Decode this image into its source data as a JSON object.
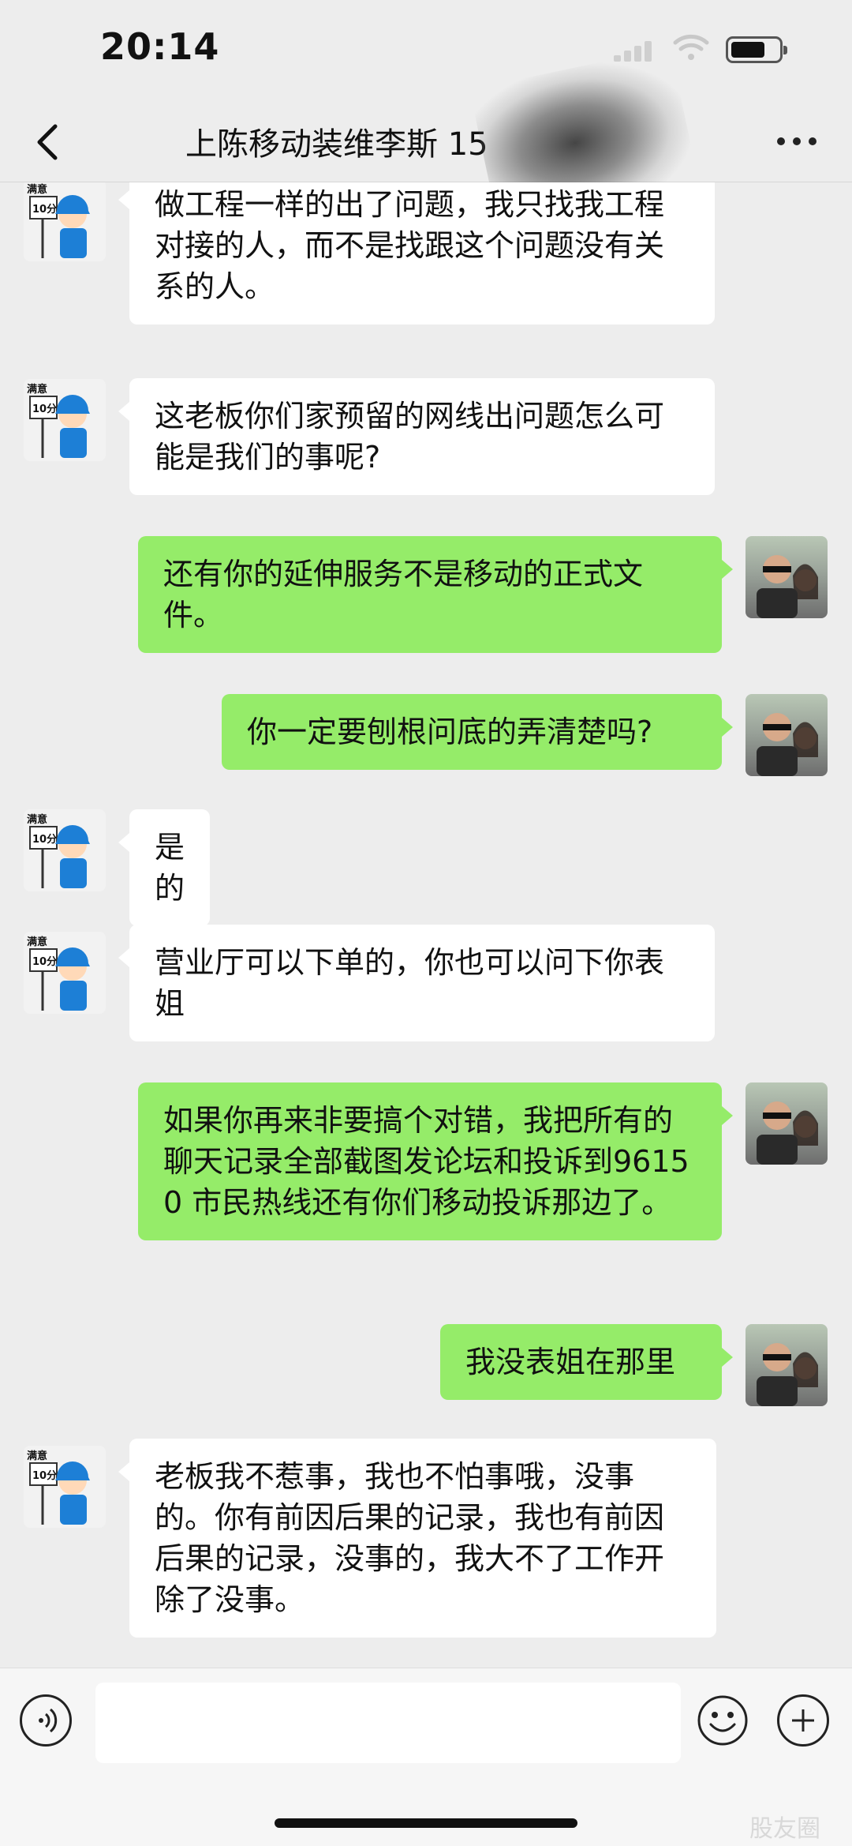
{
  "status": {
    "time": "20:14"
  },
  "header": {
    "title": "上陈移动装维李斯 15"
  },
  "messages": [
    {
      "from": "agent",
      "text": "做工程一样的出了问题，我只找我工程对接的人，而不是找跟这个问题没有关系的人。"
    },
    {
      "from": "agent",
      "text": "这老板你们家预留的网线出问题怎么可能是我们的事呢?"
    },
    {
      "from": "user",
      "text": "还有你的延伸服务不是移动的正式文件。"
    },
    {
      "from": "user",
      "text": "你一定要刨根问底的弄清楚吗?"
    },
    {
      "from": "agent",
      "text": "是的"
    },
    {
      "from": "agent",
      "text": "营业厅可以下单的，你也可以问下你表姐"
    },
    {
      "from": "user",
      "text": "如果你再来非要搞个对错，我把所有的聊天记录全部截图发论坛和投诉到96150 市民热线还有你们移动投诉那边了。"
    },
    {
      "from": "user",
      "text": "我没表姐在那里"
    },
    {
      "from": "agent",
      "text": "老板我不惹事，我也不怕事哦，没事的。你有前因后果的记录，我也有前因后果的记录，没事的，我大不了工作开除了没事。"
    }
  ],
  "agent_avatar": {
    "badge_top": "满意",
    "badge_sign": "10分"
  },
  "input": {
    "placeholder": ""
  },
  "watermark": "股友圈"
}
